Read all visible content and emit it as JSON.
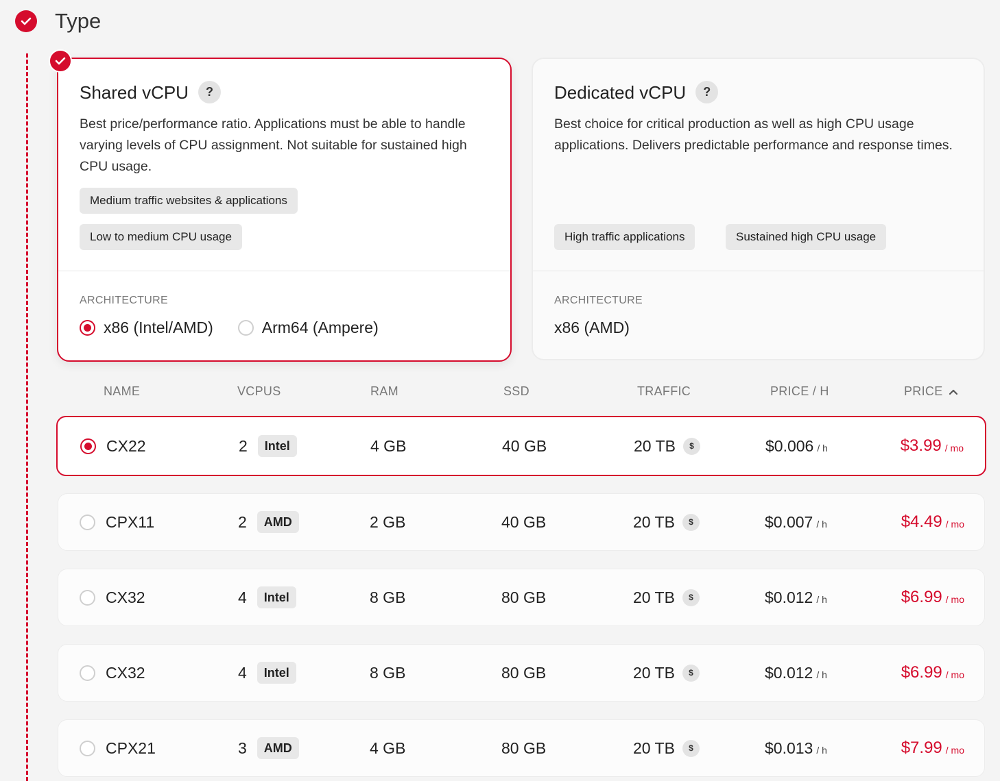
{
  "step": {
    "title": "Type"
  },
  "cards": [
    {
      "title": "Shared vCPU",
      "help": "?",
      "description": "Best price/performance ratio. Applications must be able to handle varying levels of CPU assignment. Not suitable for sustained high CPU usage.",
      "tags": [
        "Medium traffic websites & applications",
        "Low to medium CPU usage"
      ],
      "arch_label": "ARCHITECTURE",
      "arch_options": [
        "x86 (Intel/AMD)",
        "Arm64 (Ampere)"
      ],
      "selected": true
    },
    {
      "title": "Dedicated vCPU",
      "help": "?",
      "description": "Best choice for critical production as well as high CPU usage applications. Delivers predictable performance and response times.",
      "tags": [
        "High traffic applications",
        "Sustained high CPU usage"
      ],
      "arch_label": "ARCHITECTURE",
      "arch_value": "x86 (AMD)",
      "selected": false
    }
  ],
  "table": {
    "headers": {
      "name": "NAME",
      "vcpus": "VCPUS",
      "ram": "RAM",
      "ssd": "SSD",
      "traffic": "TRAFFIC",
      "price_h": "PRICE / H",
      "price": "PRICE"
    },
    "dollar_icon": "$",
    "hour_unit": "/ h",
    "month_unit": "/ mo",
    "rows": [
      {
        "name": "CX22",
        "vcpus": "2",
        "cpu": "Intel",
        "ram": "4 GB",
        "ssd": "40 GB",
        "traffic": "20 TB",
        "price_h": "$0.006",
        "price": "$3.99",
        "selected": true
      },
      {
        "name": "CPX11",
        "vcpus": "2",
        "cpu": "AMD",
        "ram": "2 GB",
        "ssd": "40 GB",
        "traffic": "20 TB",
        "price_h": "$0.007",
        "price": "$4.49"
      },
      {
        "name": "CX32",
        "vcpus": "4",
        "cpu": "Intel",
        "ram": "8 GB",
        "ssd": "80 GB",
        "traffic": "20 TB",
        "price_h": "$0.012",
        "price": "$6.99"
      },
      {
        "name": "CX32",
        "vcpus": "4",
        "cpu": "Intel",
        "ram": "8 GB",
        "ssd": "80 GB",
        "traffic": "20 TB",
        "price_h": "$0.012",
        "price": "$6.99"
      },
      {
        "name": "CPX21",
        "vcpus": "3",
        "cpu": "AMD",
        "ram": "4 GB",
        "ssd": "80 GB",
        "traffic": "20 TB",
        "price_h": "$0.013",
        "price": "$7.99"
      }
    ]
  },
  "colors": {
    "accent": "#d50c2d"
  }
}
